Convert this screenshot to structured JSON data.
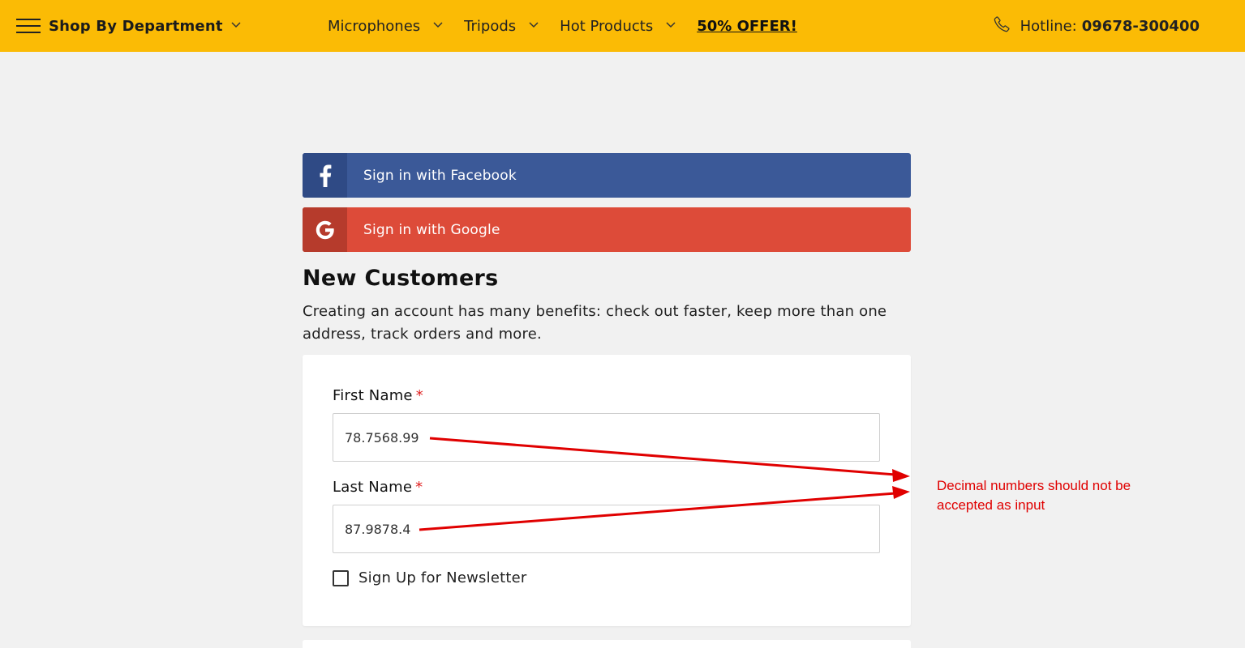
{
  "header": {
    "department_label": "Shop By Department",
    "nav": [
      {
        "label": "Microphones",
        "has_dropdown": true
      },
      {
        "label": "Tripods",
        "has_dropdown": true
      },
      {
        "label": "Hot Products",
        "has_dropdown": true
      },
      {
        "label": "50% OFFER!",
        "has_dropdown": false
      }
    ],
    "hotline_prefix": "Hotline:",
    "hotline_number": "09678-300400"
  },
  "social": {
    "facebook_label": "Sign in with Facebook",
    "google_label": "Sign in with Google"
  },
  "new_customers": {
    "title": "New Customers",
    "description": "Creating an account has many benefits: check out faster, keep more than one address, track orders and more."
  },
  "form": {
    "first_name_label": "First Name",
    "first_name_value": "78.7568.99",
    "last_name_label": "Last Name",
    "last_name_value": "87.9878.4",
    "required_marker": "*",
    "newsletter_label": "Sign Up for Newsletter",
    "newsletter_checked": false
  },
  "annotation": {
    "text": "Decimal numbers should not be accepted as input"
  },
  "colors": {
    "topbar": "#fbbb05",
    "facebook": "#3b5998",
    "google": "#dd4b39",
    "annotation": "#e00000"
  }
}
